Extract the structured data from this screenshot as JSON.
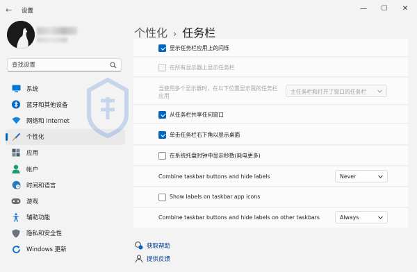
{
  "window": {
    "title": "设置",
    "back_glyph": "←",
    "minimize_glyph": "—",
    "maximize_glyph": "☐",
    "close_glyph": "✕"
  },
  "search": {
    "placeholder": "查找设置"
  },
  "sidebar": {
    "items": [
      {
        "label": "系统",
        "icon": "monitor-icon",
        "color": "#0078d4"
      },
      {
        "label": "蓝牙和其他设备",
        "icon": "bluetooth-icon",
        "color": "#0067c0"
      },
      {
        "label": "网络和 Internet",
        "icon": "wifi-icon",
        "color": "#1a86d8"
      },
      {
        "label": "个性化",
        "icon": "paintbrush-icon",
        "color": "#e6862d",
        "active": true
      },
      {
        "label": "应用",
        "icon": "apps-icon",
        "color": "#4a5a6e"
      },
      {
        "label": "帐户",
        "icon": "account-icon",
        "color": "#1e9b6e"
      },
      {
        "label": "时间和语言",
        "icon": "globe-clock-icon",
        "color": "#2a7ab8"
      },
      {
        "label": "游戏",
        "icon": "gamepad-icon",
        "color": "#6b6b6b"
      },
      {
        "label": "辅助功能",
        "icon": "accessibility-icon",
        "color": "#2d7fd0"
      },
      {
        "label": "隐私和安全性",
        "icon": "shield-icon",
        "color": "#6b7480"
      },
      {
        "label": "Windows 更新",
        "icon": "update-icon",
        "color": "#0a6cc7"
      }
    ]
  },
  "header": {
    "parent": "个性化",
    "separator": "›",
    "current": "任务栏"
  },
  "settings": {
    "rows": [
      {
        "label": "显示任务栏应用上的闪烁",
        "checked": true,
        "disabled": false
      },
      {
        "label": "在所有显示器上显示任务栏",
        "checked": false,
        "disabled": true
      },
      {
        "label": "当使用多个显示器时，在以下位置显示我的任务栏应用",
        "checked": false,
        "disabled": true,
        "dropdown": "主任务栏和打开了窗口的任务栏"
      },
      {
        "label": "从任务栏共享任何窗口",
        "checked": true,
        "disabled": false
      },
      {
        "label": "单击任务栏右下角以显示桌面",
        "checked": true,
        "disabled": false
      },
      {
        "label": "在系统托盘时钟中显示秒数(耗电更多)",
        "checked": false,
        "disabled": false
      },
      {
        "label": "Combine taskbar buttons and hide labels",
        "dropdown": "Never"
      },
      {
        "label": "Show labels on taskbar app icons",
        "checked": false,
        "disabled": false
      },
      {
        "label": "Combine taskbar buttons and hide labels on other taskbars",
        "dropdown": "Always"
      }
    ]
  },
  "links": {
    "help": "获取帮助",
    "feedback": "提供反馈"
  },
  "colors": {
    "accent": "#0067c0",
    "background": "#f3f3f3",
    "card": "#fbfbfb"
  }
}
